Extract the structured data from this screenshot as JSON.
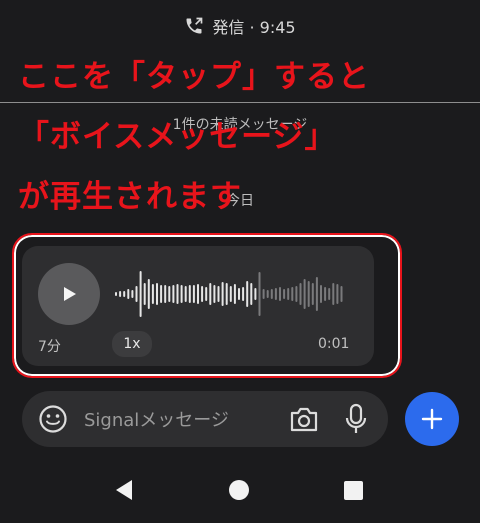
{
  "call_bar": {
    "icon": "outgoing-call-icon",
    "label": "発信 · 9:45"
  },
  "chat": {
    "unread_label": "1件の未読メッセージ",
    "date_label": "今日"
  },
  "annotation": {
    "color": "#e8141b",
    "lines": [
      "ここを「タップ」すると",
      "「ボイスメッセージ」",
      "が再生されます"
    ]
  },
  "voice_message": {
    "time_ago": "7分",
    "speed": "1x",
    "duration": "0:01",
    "progress": 0.62
  },
  "compose": {
    "placeholder": "Signalメッセージ",
    "value": "",
    "icons": [
      "emoji-icon",
      "camera-icon",
      "mic-icon",
      "plus-icon"
    ],
    "accent": "#2c6bed"
  },
  "nav": {
    "icons": [
      "back-icon",
      "home-icon",
      "recents-icon"
    ]
  }
}
